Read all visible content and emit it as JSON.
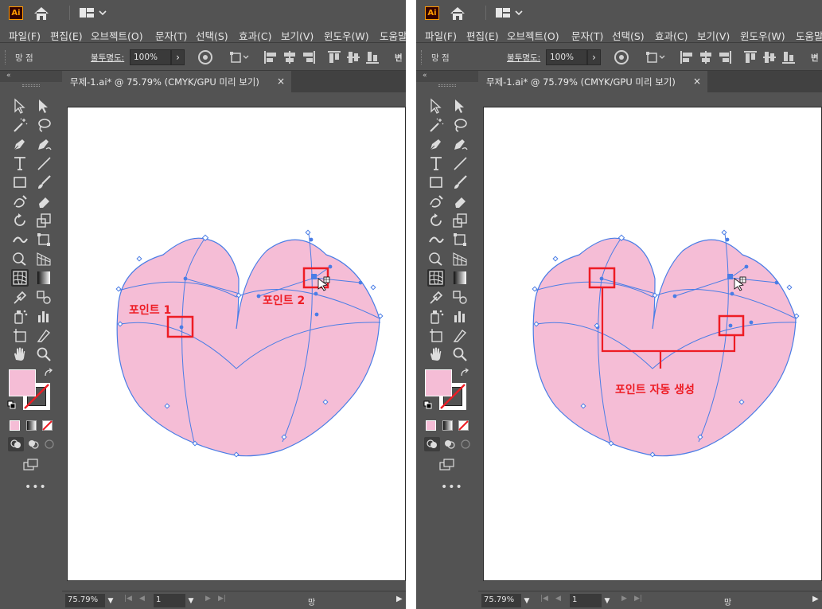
{
  "app": {
    "logo_text": "Ai"
  },
  "menu": [
    "파일(F)",
    "편집(E)",
    "오브젝트(O)",
    "문자(T)",
    "선택(S)",
    "효과(C)",
    "보기(V)",
    "윈도우(W)",
    "도움말"
  ],
  "control_bar": {
    "mode_label": "망 점",
    "opacity_label": "불투명도:",
    "opacity_value": "100%",
    "next_label": "변"
  },
  "document": {
    "tab_title": "무제-1.ai* @ 75.79% (CMYK/GPU 미리 보기)",
    "close_symbol": "×"
  },
  "status_bar": {
    "zoom": "75.79%",
    "page": "1",
    "status_text": "망"
  },
  "annotations": {
    "left": {
      "point1": "포인트 1",
      "point2": "포인트 2"
    },
    "right": {
      "auto_points": "포인트 자동 생성"
    }
  },
  "colors": {
    "ui_background": "#535353",
    "heart_fill": "#f5bdd6",
    "mesh_line": "#4a7de6",
    "annotation_red": "#ee1c24",
    "fill_swatch": "#f5bdd6"
  },
  "tools": [
    "selection-tool",
    "direct-selection-tool",
    "magic-wand-tool",
    "lasso-tool",
    "pen-tool",
    "curvature-tool",
    "type-tool",
    "line-tool",
    "rectangle-tool",
    "paintbrush-tool",
    "shaper-tool",
    "eraser-tool",
    "rotate-tool",
    "scale-tool",
    "width-tool",
    "free-transform-tool",
    "shape-builder-tool",
    "perspective-grid-tool",
    "mesh-tool",
    "gradient-tool",
    "eyedropper-tool",
    "blend-tool",
    "symbol-sprayer-tool",
    "column-graph-tool",
    "artboard-tool",
    "slice-tool",
    "hand-tool",
    "zoom-tool"
  ]
}
